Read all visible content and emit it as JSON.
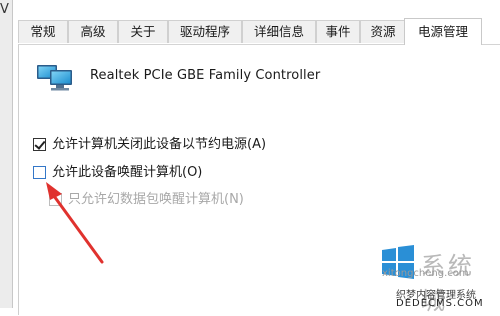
{
  "window": {
    "left_edge_char": "V"
  },
  "tabs": [
    {
      "label": "常规",
      "active": false
    },
    {
      "label": "高级",
      "active": false
    },
    {
      "label": "关于",
      "active": false
    },
    {
      "label": "驱动程序",
      "active": false
    },
    {
      "label": "详细信息",
      "active": false
    },
    {
      "label": "事件",
      "active": false
    },
    {
      "label": "资源",
      "active": false
    },
    {
      "label": "电源管理",
      "active": true
    }
  ],
  "device": {
    "icon": "network-adapter-icon",
    "name": "Realtek PCIe GBE Family Controller"
  },
  "options": [
    {
      "label": "允许计算机关闭此设备以节约电源(A)",
      "checked": true,
      "enabled": true
    },
    {
      "label": "允许此设备唤醒计算机(O)",
      "checked": false,
      "enabled": true
    },
    {
      "label": "只允许幻数据包唤醒计算机(N)",
      "checked": false,
      "enabled": false
    }
  ],
  "annotation": {
    "arrow_color": "#e0322e"
  },
  "watermark": {
    "logo_text": "系统城",
    "url": "xitongcheng.com",
    "line2": "织梦内容管理系统",
    "line3": "DEDECMS.COM"
  }
}
